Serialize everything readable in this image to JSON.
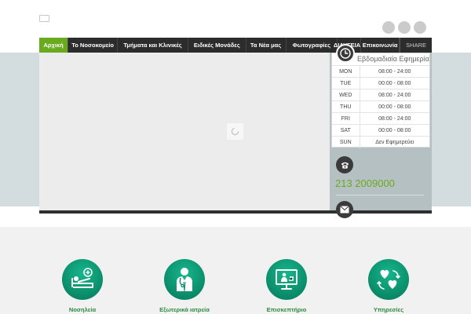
{
  "nav": {
    "items": [
      "Αρχική",
      "Το Νοσοκομείο",
      "Τμήματα και Κλινικές",
      "Ειδικές Μονάδες",
      "Τα Νέα μας",
      "Φωτογραφίες",
      "ΔΙΑΥΓΕΙΑ",
      "Επικοινωνία"
    ],
    "share_label": "SHARE"
  },
  "schedule": {
    "title": "Εβδομαδιαία Εφημερία",
    "rows": [
      {
        "day": "MON",
        "hours": "08:00 - 24:00"
      },
      {
        "day": "TUE",
        "hours": "00:00 - 08:00"
      },
      {
        "day": "WED",
        "hours": "08:00 - 24:00"
      },
      {
        "day": "THU",
        "hours": "00:00 - 08:00"
      },
      {
        "day": "FRI",
        "hours": "08:00 - 24:00"
      },
      {
        "day": "SAT",
        "hours": "00:00 - 08:00"
      },
      {
        "day": "SUN",
        "hours": "Δεν Εφημερεύει"
      }
    ]
  },
  "contact": {
    "phone": "213 2009000"
  },
  "services": [
    {
      "label": "Νοσηλεία",
      "icon": "hospital-bed-icon"
    },
    {
      "label": "Εξωτερικά ιατρεία",
      "icon": "doctor-icon"
    },
    {
      "label": "Επισκεπτήριο",
      "icon": "monitor-visit-icon"
    },
    {
      "label": "Υπηρεσίες",
      "icon": "hearts-icon"
    }
  ],
  "colors": {
    "accent": "#6aaa1e",
    "nav_bg": "#2c2c2c",
    "service_icon": "#0a8a68"
  }
}
